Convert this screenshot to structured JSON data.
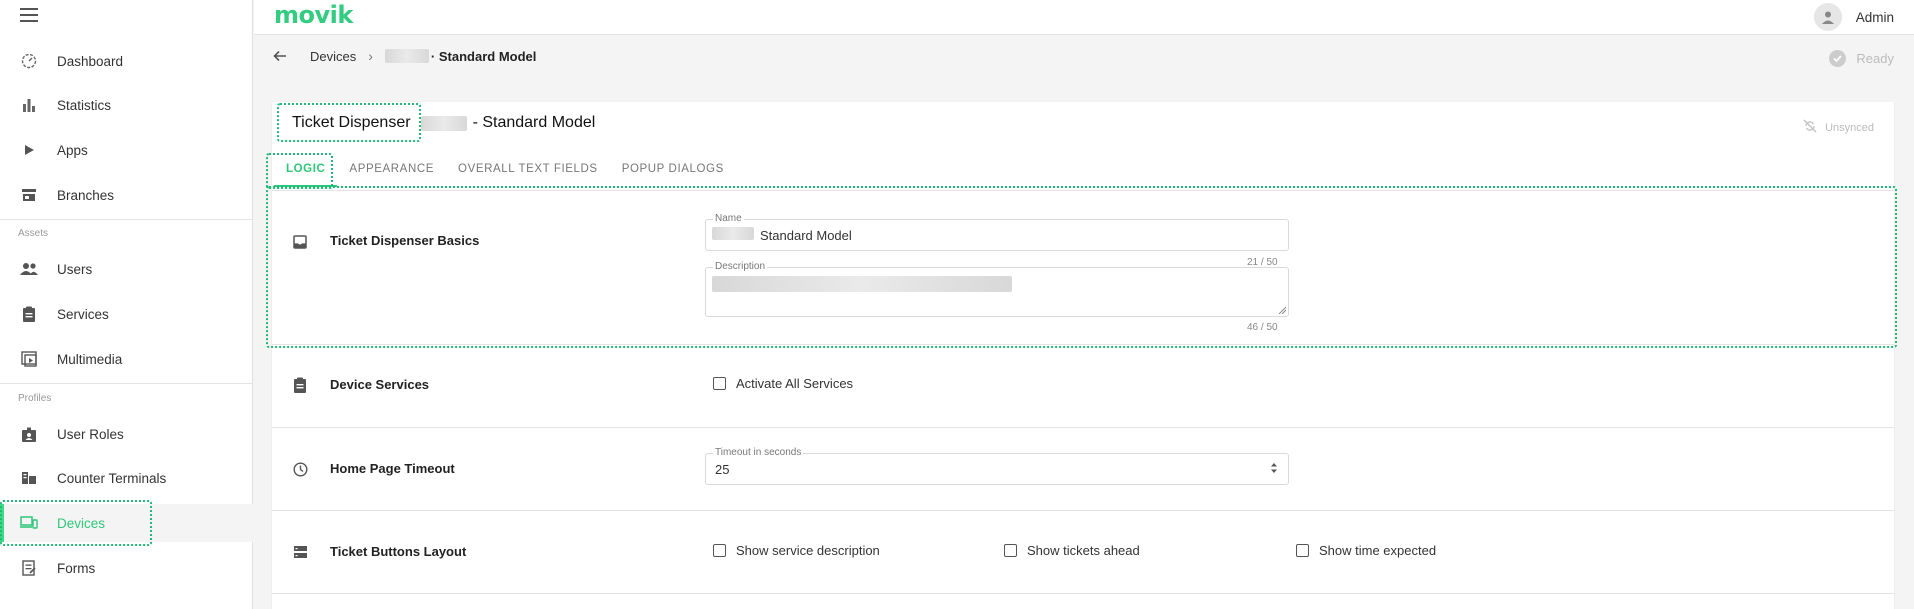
{
  "app": {
    "logo_text": "movik",
    "user_name": "Admin"
  },
  "sidebar": {
    "items": [
      {
        "id": "dashboard",
        "label": "Dashboard",
        "icon": "dashboard-icon"
      },
      {
        "id": "statistics",
        "label": "Statistics",
        "icon": "bar-chart-icon"
      },
      {
        "id": "apps",
        "label": "Apps",
        "icon": "play-icon"
      },
      {
        "id": "branches",
        "label": "Branches",
        "icon": "store-icon"
      },
      {
        "id": "users",
        "label": "Users",
        "icon": "people-icon"
      },
      {
        "id": "services",
        "label": "Services",
        "icon": "clipboard-icon"
      },
      {
        "id": "multimedia",
        "label": "Multimedia",
        "icon": "media-icon"
      },
      {
        "id": "user-roles",
        "label": "User Roles",
        "icon": "badge-icon"
      },
      {
        "id": "counter-terminals",
        "label": "Counter Terminals",
        "icon": "desk-icon"
      },
      {
        "id": "devices",
        "label": "Devices",
        "icon": "devices-icon",
        "active": true
      },
      {
        "id": "forms",
        "label": "Forms",
        "icon": "form-icon"
      }
    ],
    "sections": {
      "assets": "Assets",
      "profiles": "Profiles"
    }
  },
  "breadcrumb": {
    "parent": "Devices",
    "current": "· Standard Model"
  },
  "status": {
    "ready": "Ready",
    "sync": "Unsynced"
  },
  "page": {
    "title_type": "Ticket Dispenser",
    "title_rest": "- Standard Model",
    "tabs": [
      "LOGIC",
      "APPEARANCE",
      "OVERALL TEXT FIELDS",
      "POPUP DIALOGS"
    ],
    "active_tab": "LOGIC"
  },
  "sections": {
    "basics": {
      "title": "Ticket Dispenser Basics",
      "name_label": "Name",
      "name_value": "Standard Model",
      "name_counter": "21 / 50",
      "description_label": "Description",
      "description_counter": "46 / 50"
    },
    "services": {
      "title": "Device Services",
      "activate_all": "Activate All Services"
    },
    "timeout": {
      "title": "Home Page Timeout",
      "label": "Timeout in seconds",
      "value": "25"
    },
    "layout": {
      "title": "Ticket Buttons Layout",
      "show_description": "Show service description",
      "show_ahead": "Show tickets ahead",
      "show_expected": "Show time expected"
    }
  },
  "colors": {
    "accent": "#2fc77a",
    "brand": "#33cc80",
    "focus": "#1fb978"
  }
}
